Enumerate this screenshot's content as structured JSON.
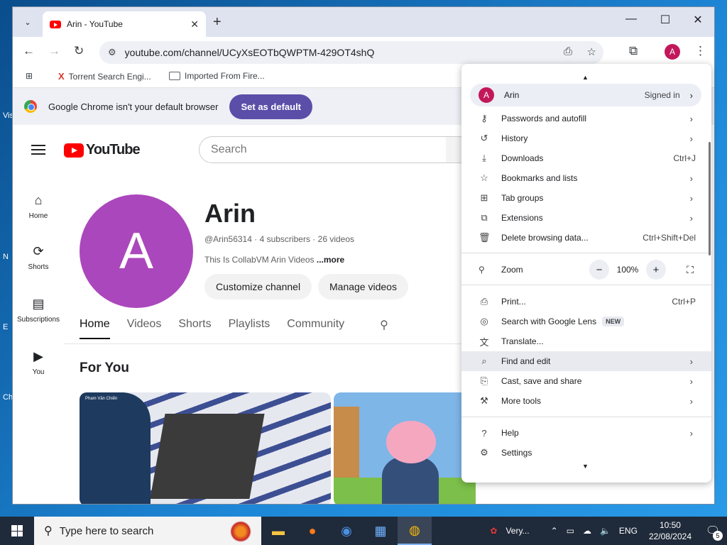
{
  "desktop": {
    "labels": [
      "Vis",
      "N",
      "E",
      "Ch"
    ]
  },
  "tab": {
    "title": "Arin - YouTube"
  },
  "omnibox": {
    "url": "youtube.com/channel/UCyXsEOTbQWPTM-429OT4shQ"
  },
  "bookmarks": [
    {
      "label": "Torrent Search Engi..."
    },
    {
      "label": "Imported From Fire..."
    }
  ],
  "infobar": {
    "text": "Google Chrome isn't your default browser",
    "button": "Set as default"
  },
  "youtube": {
    "logo": "YouTube",
    "search_placeholder": "Search",
    "sidebar": [
      {
        "icon": "home-icon",
        "label": "Home"
      },
      {
        "icon": "shorts-icon",
        "label": "Shorts"
      },
      {
        "icon": "subscriptions-icon",
        "label": "Subscriptions"
      },
      {
        "icon": "you-icon",
        "label": "You"
      }
    ],
    "channel": {
      "avatar_letter": "A",
      "name": "Arin",
      "handle": "@Arin56314",
      "subscribers": "4 subscribers",
      "videos": "26 videos",
      "meta_separator": "·",
      "description": "This Is CollabVM Arin Videos",
      "more": "...more",
      "customize": "Customize channel",
      "manage": "Manage videos"
    },
    "tabs": [
      "Home",
      "Videos",
      "Shorts",
      "Playlists",
      "Community"
    ],
    "section_title": "For You",
    "thumb_caption": "Pham Văn Chiến"
  },
  "menu": {
    "profile": {
      "avatar": "A",
      "name": "Arin",
      "status": "Signed in"
    },
    "items1": [
      {
        "icon": "key-icon",
        "label": "Passwords and autofill",
        "shortcut": "",
        "arrow": true
      },
      {
        "icon": "history-icon",
        "label": "History",
        "shortcut": "",
        "arrow": true
      },
      {
        "icon": "download-icon",
        "label": "Downloads",
        "shortcut": "Ctrl+J",
        "arrow": false
      },
      {
        "icon": "star-icon",
        "label": "Bookmarks and lists",
        "shortcut": "",
        "arrow": true
      },
      {
        "icon": "tab-groups-icon",
        "label": "Tab groups",
        "shortcut": "",
        "arrow": true
      },
      {
        "icon": "extensions-icon",
        "label": "Extensions",
        "shortcut": "",
        "arrow": true
      },
      {
        "icon": "trash-icon",
        "label": "Delete browsing data...",
        "shortcut": "Ctrl+Shift+Del",
        "arrow": false
      }
    ],
    "zoom": {
      "label": "Zoom",
      "value": "100%",
      "minus": "−",
      "plus": "+"
    },
    "items2": [
      {
        "icon": "print-icon",
        "label": "Print...",
        "shortcut": "Ctrl+P",
        "arrow": false,
        "badge": ""
      },
      {
        "icon": "google-lens-icon",
        "label": "Search with Google Lens",
        "shortcut": "",
        "arrow": false,
        "badge": "NEW"
      },
      {
        "icon": "translate-icon",
        "label": "Translate...",
        "shortcut": "",
        "arrow": false,
        "badge": ""
      },
      {
        "icon": "find-icon",
        "label": "Find and edit",
        "shortcut": "",
        "arrow": true,
        "badge": ""
      },
      {
        "icon": "cast-icon",
        "label": "Cast, save and share",
        "shortcut": "",
        "arrow": true,
        "badge": ""
      },
      {
        "icon": "toolbox-icon",
        "label": "More tools",
        "shortcut": "",
        "arrow": true,
        "badge": ""
      }
    ],
    "items3": [
      {
        "icon": "help-icon",
        "label": "Help",
        "arrow": true
      },
      {
        "icon": "settings-icon",
        "label": "Settings",
        "arrow": false
      }
    ]
  },
  "taskbar": {
    "search_placeholder": "Type here to search",
    "media_label": "Very...",
    "lang": "ENG",
    "time": "10:50",
    "date": "22/08/2024",
    "notifications": "5"
  }
}
